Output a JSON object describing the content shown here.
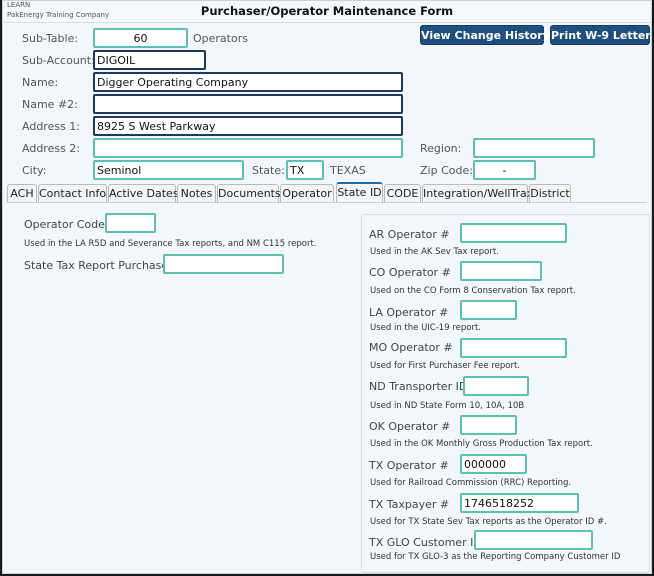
{
  "titlebar": {
    "environment": "LEARN",
    "company": "PakEnergy Training Company",
    "title": "Purchaser/Operator Maintenance Form"
  },
  "buttons": {
    "view_change_history": "View Change History",
    "print_w9_letter": "Print W-9 Letter"
  },
  "header_form": {
    "sub_table": {
      "label": "Sub-Table:",
      "value": "60",
      "description": "Operators"
    },
    "sub_account": {
      "label": "Sub-Account:",
      "value": "DIGOIL"
    },
    "name": {
      "label": "Name:",
      "value": "Digger Operating Company"
    },
    "name2": {
      "label": "Name #2:",
      "value": ""
    },
    "address1": {
      "label": "Address 1:",
      "value": "8925 S West Parkway"
    },
    "address2": {
      "label": "Address 2:",
      "value": ""
    },
    "city": {
      "label": "City:",
      "value": "Seminol"
    },
    "state": {
      "label": "State:",
      "value": "TX",
      "description": "TEXAS"
    },
    "region": {
      "label": "Region:",
      "value": ""
    },
    "zip": {
      "label": "Zip Code:",
      "value": "-"
    }
  },
  "tabs": [
    {
      "label": "ACH",
      "active": false
    },
    {
      "label": "Contact Info",
      "active": false
    },
    {
      "label": "Active Dates",
      "active": false
    },
    {
      "label": "Notes",
      "active": false
    },
    {
      "label": "Documents",
      "active": false
    },
    {
      "label": "Operator",
      "active": false
    },
    {
      "label": "State ID",
      "active": true
    },
    {
      "label": "CODE",
      "active": false
    },
    {
      "label": "Integration/WellTrax",
      "active": false
    },
    {
      "label": "District",
      "active": false
    }
  ],
  "state_id": {
    "operator_code": {
      "label": "Operator Code",
      "value": "",
      "note": "Used in the LA R5D and Severance Tax reports, and NM C115 report."
    },
    "state_tax_report_purchaser": {
      "label": "State Tax Report Purchaser",
      "value": ""
    },
    "fields": [
      {
        "label": "AR Operator #",
        "value": "",
        "note": "Used in the AK Sev Tax report."
      },
      {
        "label": "CO Operator #",
        "value": "",
        "note": "Used on the CO Form 8 Conservation Tax report."
      },
      {
        "label": "LA Operator #",
        "value": "",
        "note": "Used in the UIC-19 report."
      },
      {
        "label": "MO Operator #",
        "value": "",
        "note": "Used for First Purchaser Fee report."
      },
      {
        "label": "ND Transporter ID",
        "value": "",
        "note": "Used in ND State Form 10, 10A, 10B"
      },
      {
        "label": "OK Operator #",
        "value": "",
        "note": "Used in the OK Monthly Gross Production Tax report."
      },
      {
        "label": "TX Operator #",
        "value": "000000",
        "note": "Used for Railroad Commission (RRC) Reporting."
      },
      {
        "label": "TX Taxpayer #",
        "value": "1746518252",
        "note": "Used for TX State Sev Tax reports as the Operator ID #."
      },
      {
        "label": "TX GLO Customer ID",
        "value": "",
        "note": "Used for TX GLO-3 as the Reporting Company Customer ID"
      }
    ]
  }
}
